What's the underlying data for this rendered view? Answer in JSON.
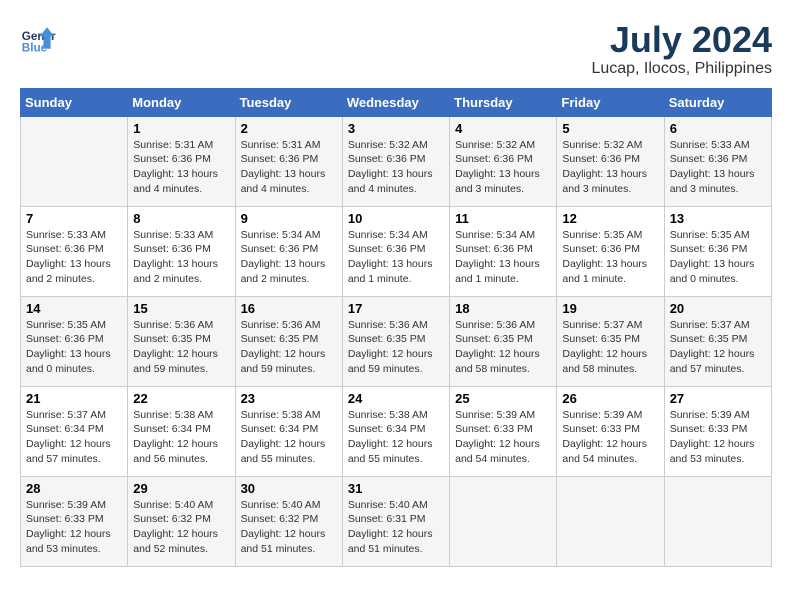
{
  "header": {
    "logo_line1": "General",
    "logo_line2": "Blue",
    "month": "July 2024",
    "location": "Lucap, Ilocos, Philippines"
  },
  "columns": [
    "Sunday",
    "Monday",
    "Tuesday",
    "Wednesday",
    "Thursday",
    "Friday",
    "Saturday"
  ],
  "weeks": [
    [
      {
        "day": "",
        "detail": ""
      },
      {
        "day": "1",
        "detail": "Sunrise: 5:31 AM\nSunset: 6:36 PM\nDaylight: 13 hours\nand 4 minutes."
      },
      {
        "day": "2",
        "detail": "Sunrise: 5:31 AM\nSunset: 6:36 PM\nDaylight: 13 hours\nand 4 minutes."
      },
      {
        "day": "3",
        "detail": "Sunrise: 5:32 AM\nSunset: 6:36 PM\nDaylight: 13 hours\nand 4 minutes."
      },
      {
        "day": "4",
        "detail": "Sunrise: 5:32 AM\nSunset: 6:36 PM\nDaylight: 13 hours\nand 3 minutes."
      },
      {
        "day": "5",
        "detail": "Sunrise: 5:32 AM\nSunset: 6:36 PM\nDaylight: 13 hours\nand 3 minutes."
      },
      {
        "day": "6",
        "detail": "Sunrise: 5:33 AM\nSunset: 6:36 PM\nDaylight: 13 hours\nand 3 minutes."
      }
    ],
    [
      {
        "day": "7",
        "detail": "Sunrise: 5:33 AM\nSunset: 6:36 PM\nDaylight: 13 hours\nand 2 minutes."
      },
      {
        "day": "8",
        "detail": "Sunrise: 5:33 AM\nSunset: 6:36 PM\nDaylight: 13 hours\nand 2 minutes."
      },
      {
        "day": "9",
        "detail": "Sunrise: 5:34 AM\nSunset: 6:36 PM\nDaylight: 13 hours\nand 2 minutes."
      },
      {
        "day": "10",
        "detail": "Sunrise: 5:34 AM\nSunset: 6:36 PM\nDaylight: 13 hours\nand 1 minute."
      },
      {
        "day": "11",
        "detail": "Sunrise: 5:34 AM\nSunset: 6:36 PM\nDaylight: 13 hours\nand 1 minute."
      },
      {
        "day": "12",
        "detail": "Sunrise: 5:35 AM\nSunset: 6:36 PM\nDaylight: 13 hours\nand 1 minute."
      },
      {
        "day": "13",
        "detail": "Sunrise: 5:35 AM\nSunset: 6:36 PM\nDaylight: 13 hours\nand 0 minutes."
      }
    ],
    [
      {
        "day": "14",
        "detail": "Sunrise: 5:35 AM\nSunset: 6:36 PM\nDaylight: 13 hours\nand 0 minutes."
      },
      {
        "day": "15",
        "detail": "Sunrise: 5:36 AM\nSunset: 6:35 PM\nDaylight: 12 hours\nand 59 minutes."
      },
      {
        "day": "16",
        "detail": "Sunrise: 5:36 AM\nSunset: 6:35 PM\nDaylight: 12 hours\nand 59 minutes."
      },
      {
        "day": "17",
        "detail": "Sunrise: 5:36 AM\nSunset: 6:35 PM\nDaylight: 12 hours\nand 59 minutes."
      },
      {
        "day": "18",
        "detail": "Sunrise: 5:36 AM\nSunset: 6:35 PM\nDaylight: 12 hours\nand 58 minutes."
      },
      {
        "day": "19",
        "detail": "Sunrise: 5:37 AM\nSunset: 6:35 PM\nDaylight: 12 hours\nand 58 minutes."
      },
      {
        "day": "20",
        "detail": "Sunrise: 5:37 AM\nSunset: 6:35 PM\nDaylight: 12 hours\nand 57 minutes."
      }
    ],
    [
      {
        "day": "21",
        "detail": "Sunrise: 5:37 AM\nSunset: 6:34 PM\nDaylight: 12 hours\nand 57 minutes."
      },
      {
        "day": "22",
        "detail": "Sunrise: 5:38 AM\nSunset: 6:34 PM\nDaylight: 12 hours\nand 56 minutes."
      },
      {
        "day": "23",
        "detail": "Sunrise: 5:38 AM\nSunset: 6:34 PM\nDaylight: 12 hours\nand 55 minutes."
      },
      {
        "day": "24",
        "detail": "Sunrise: 5:38 AM\nSunset: 6:34 PM\nDaylight: 12 hours\nand 55 minutes."
      },
      {
        "day": "25",
        "detail": "Sunrise: 5:39 AM\nSunset: 6:33 PM\nDaylight: 12 hours\nand 54 minutes."
      },
      {
        "day": "26",
        "detail": "Sunrise: 5:39 AM\nSunset: 6:33 PM\nDaylight: 12 hours\nand 54 minutes."
      },
      {
        "day": "27",
        "detail": "Sunrise: 5:39 AM\nSunset: 6:33 PM\nDaylight: 12 hours\nand 53 minutes."
      }
    ],
    [
      {
        "day": "28",
        "detail": "Sunrise: 5:39 AM\nSunset: 6:33 PM\nDaylight: 12 hours\nand 53 minutes."
      },
      {
        "day": "29",
        "detail": "Sunrise: 5:40 AM\nSunset: 6:32 PM\nDaylight: 12 hours\nand 52 minutes."
      },
      {
        "day": "30",
        "detail": "Sunrise: 5:40 AM\nSunset: 6:32 PM\nDaylight: 12 hours\nand 51 minutes."
      },
      {
        "day": "31",
        "detail": "Sunrise: 5:40 AM\nSunset: 6:31 PM\nDaylight: 12 hours\nand 51 minutes."
      },
      {
        "day": "",
        "detail": ""
      },
      {
        "day": "",
        "detail": ""
      },
      {
        "day": "",
        "detail": ""
      }
    ]
  ]
}
